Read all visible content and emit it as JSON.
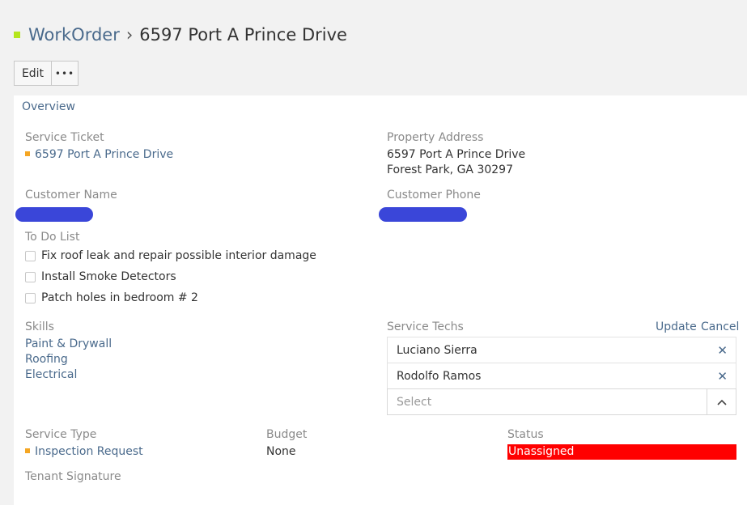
{
  "header": {
    "breadcrumb_root": "WorkOrder",
    "separator": "›",
    "title": "6597 Port A Prince Drive"
  },
  "toolbar": {
    "edit_label": "Edit",
    "more_label": "•••"
  },
  "overview": {
    "tab_label": "Overview",
    "service_ticket": {
      "label": "Service Ticket",
      "value": "6597 Port A Prince Drive"
    },
    "property_address": {
      "label": "Property Address",
      "line1": "6597 Port A Prince Drive",
      "line2": "Forest Park, GA 30297"
    },
    "customer_name": {
      "label": "Customer Name"
    },
    "customer_phone": {
      "label": "Customer Phone"
    },
    "todo": {
      "label": "To Do List",
      "items": [
        "Fix roof leak and repair possible interior damage",
        "Install Smoke Detectors",
        "Patch holes in bedroom # 2"
      ]
    },
    "skills": {
      "label": "Skills",
      "items": [
        "Paint & Drywall",
        "Roofing",
        "Electrical"
      ]
    },
    "service_techs": {
      "label": "Service Techs",
      "update_label": "Update",
      "cancel_label": "Cancel",
      "items": [
        "Luciano Sierra",
        "Rodolfo Ramos"
      ],
      "select_placeholder": "Select"
    },
    "service_type": {
      "label": "Service Type",
      "value": "Inspection Request"
    },
    "budget": {
      "label": "Budget",
      "value": "None"
    },
    "status": {
      "label": "Status",
      "value": "Unassigned",
      "color": "#ff0000"
    },
    "tenant_signature": {
      "label": "Tenant Signature"
    }
  },
  "colors": {
    "link": "#4a6a8c",
    "accent_green": "#b5e61d",
    "accent_orange": "#f5a623",
    "redaction": "#3a46d9"
  }
}
